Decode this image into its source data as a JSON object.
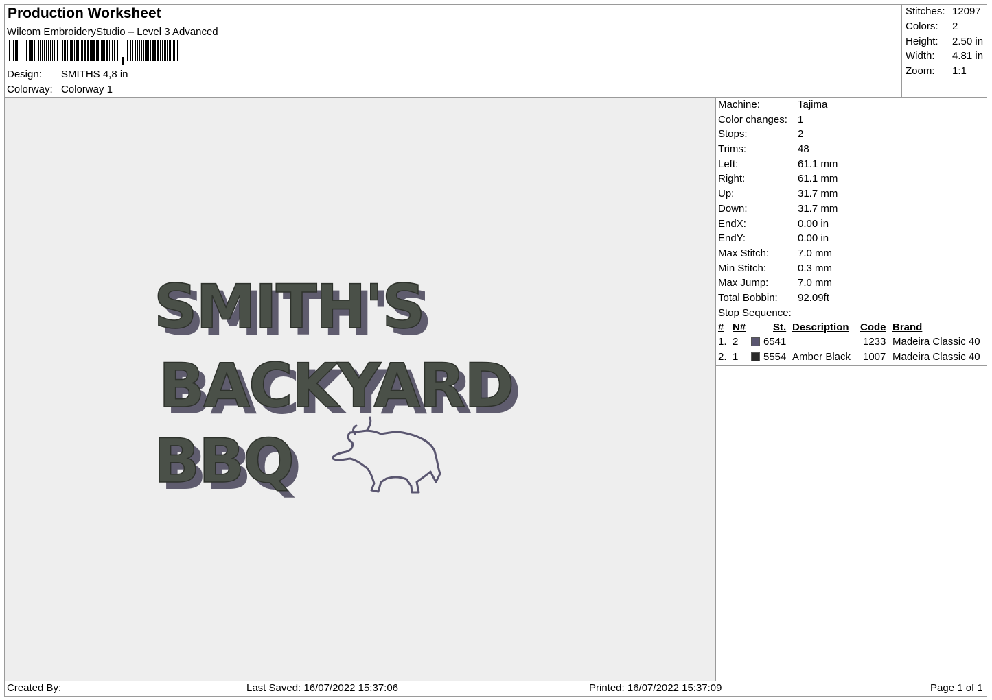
{
  "header": {
    "title": "Production Worksheet",
    "subtitle": "Wilcom EmbroideryStudio – Level 3 Advanced",
    "design_label": "Design:",
    "design_value": "SMITHS 4,8 in",
    "colorway_label": "Colorway:",
    "colorway_value": "Colorway 1"
  },
  "stats": [
    {
      "label": "Stitches:",
      "value": "12097"
    },
    {
      "label": "Colors:",
      "value": "2"
    },
    {
      "label": "Height:",
      "value": "2.50 in"
    },
    {
      "label": "Width:",
      "value": "4.81 in"
    },
    {
      "label": "Zoom:",
      "value": "1:1"
    }
  ],
  "design_preview": {
    "lines": [
      "SMITH'S",
      "BACKYARD",
      "BBQ"
    ],
    "icon": "bison-outline-icon",
    "colors": {
      "fill": "#4a5048",
      "shadow": "#5f5c6e",
      "background": "#eeeeee"
    }
  },
  "machine_info": [
    {
      "label": "Machine:",
      "value": "Tajima"
    },
    {
      "label": "Color changes:",
      "value": "1"
    },
    {
      "label": "Stops:",
      "value": "2"
    },
    {
      "label": "Trims:",
      "value": "48"
    },
    {
      "label": "Left:",
      "value": "61.1 mm"
    },
    {
      "label": "Right:",
      "value": "61.1 mm"
    },
    {
      "label": "Up:",
      "value": "31.7 mm"
    },
    {
      "label": "Down:",
      "value": "31.7 mm"
    },
    {
      "label": "EndX:",
      "value": "0.00 in"
    },
    {
      "label": "EndY:",
      "value": "0.00 in"
    },
    {
      "label": "Max Stitch:",
      "value": "7.0 mm"
    },
    {
      "label": "Min Stitch:",
      "value": "0.3 mm"
    },
    {
      "label": "Max Jump:",
      "value": "7.0 mm"
    },
    {
      "label": "Total Bobbin:",
      "value": "92.09ft"
    }
  ],
  "stop_sequence": {
    "title": "Stop Sequence:",
    "headers": {
      "num": "#",
      "n": "N#",
      "st": "St.",
      "description": "Description",
      "code": "Code",
      "brand": "Brand"
    },
    "rows": [
      {
        "num": "1.",
        "n": "2",
        "swatch": "#5a5670",
        "st": "6541",
        "description": "",
        "code": "1233",
        "brand": "Madeira Classic 40"
      },
      {
        "num": "2.",
        "n": "1",
        "swatch": "#2a2a2a",
        "st": "5554",
        "description": "Amber Black",
        "code": "1007",
        "brand": "Madeira Classic 40"
      }
    ]
  },
  "footer": {
    "created_by": "Created By:",
    "last_saved": "Last Saved: 16/07/2022 15:37:06",
    "printed": "Printed: 16/07/2022 15:37:09",
    "page": "Page 1 of 1"
  }
}
